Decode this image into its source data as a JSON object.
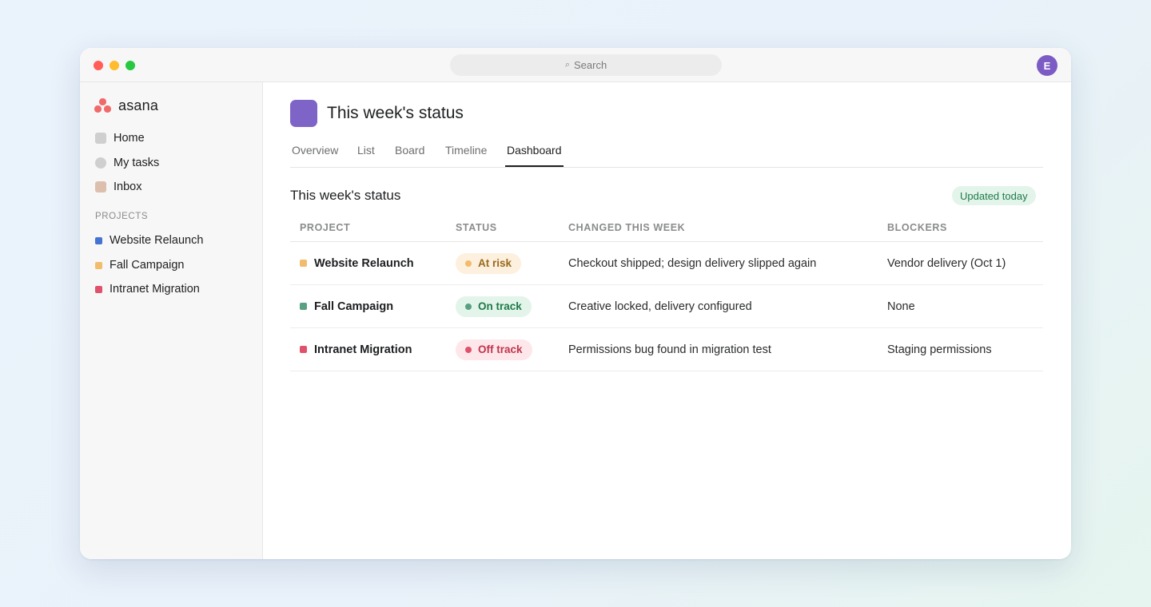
{
  "titlebar": {
    "search_placeholder": "Search",
    "avatar_initial": "E"
  },
  "sidebar": {
    "logo_text": "asana",
    "nav": [
      {
        "label": "Home",
        "icon": "home-icon",
        "color": "#cfcfcf"
      },
      {
        "label": "My tasks",
        "icon": "my-tasks-icon",
        "color": "#cfcfcf"
      },
      {
        "label": "Inbox",
        "icon": "inbox-icon",
        "color": "#dcc0ad"
      }
    ],
    "projects_heading": "PROJECTS",
    "projects": [
      {
        "label": "Website Relaunch",
        "color": "#4573d2"
      },
      {
        "label": "Fall Campaign",
        "color": "#f1bd6c"
      },
      {
        "label": "Intranet Migration",
        "color": "#e0526b"
      }
    ]
  },
  "main": {
    "project_icon_color": "#7e64c7",
    "title": "This week's status",
    "tabs": [
      {
        "label": "Overview",
        "active": false
      },
      {
        "label": "List",
        "active": false
      },
      {
        "label": "Board",
        "active": false
      },
      {
        "label": "Timeline",
        "active": false
      },
      {
        "label": "Dashboard",
        "active": true
      }
    ],
    "section_title": "This week's status",
    "updated_badge": "Updated today",
    "table": {
      "headers": [
        "PROJECT",
        "STATUS",
        "CHANGED THIS WEEK",
        "BLOCKERS"
      ],
      "rows": [
        {
          "project": "Website Relaunch",
          "project_color": "#f1bd6c",
          "status": "At risk",
          "status_key": "at-risk",
          "changed": "Checkout shipped; design delivery slipped again",
          "blockers": "Vendor delivery (Oct 1)"
        },
        {
          "project": "Fall Campaign",
          "project_color": "#58a182",
          "status": "On track",
          "status_key": "on-track",
          "changed": "Creative locked, delivery configured",
          "blockers": "None"
        },
        {
          "project": "Intranet Migration",
          "project_color": "#e0526b",
          "status": "Off track",
          "status_key": "off-track",
          "changed": "Permissions bug found in migration test",
          "blockers": "Staging permissions"
        }
      ]
    }
  },
  "colors": {
    "accent_logo": "#f06a6a",
    "at_risk_bg": "#fdf0df",
    "at_risk_text": "#9a6a1c",
    "at_risk_dot": "#f1bd6c",
    "on_track_bg": "#e3f4ea",
    "on_track_text": "#1f7a4a",
    "on_track_dot": "#58a182",
    "off_track_bg": "#fde7ea",
    "off_track_text": "#c2344d",
    "off_track_dot": "#e0526b"
  }
}
